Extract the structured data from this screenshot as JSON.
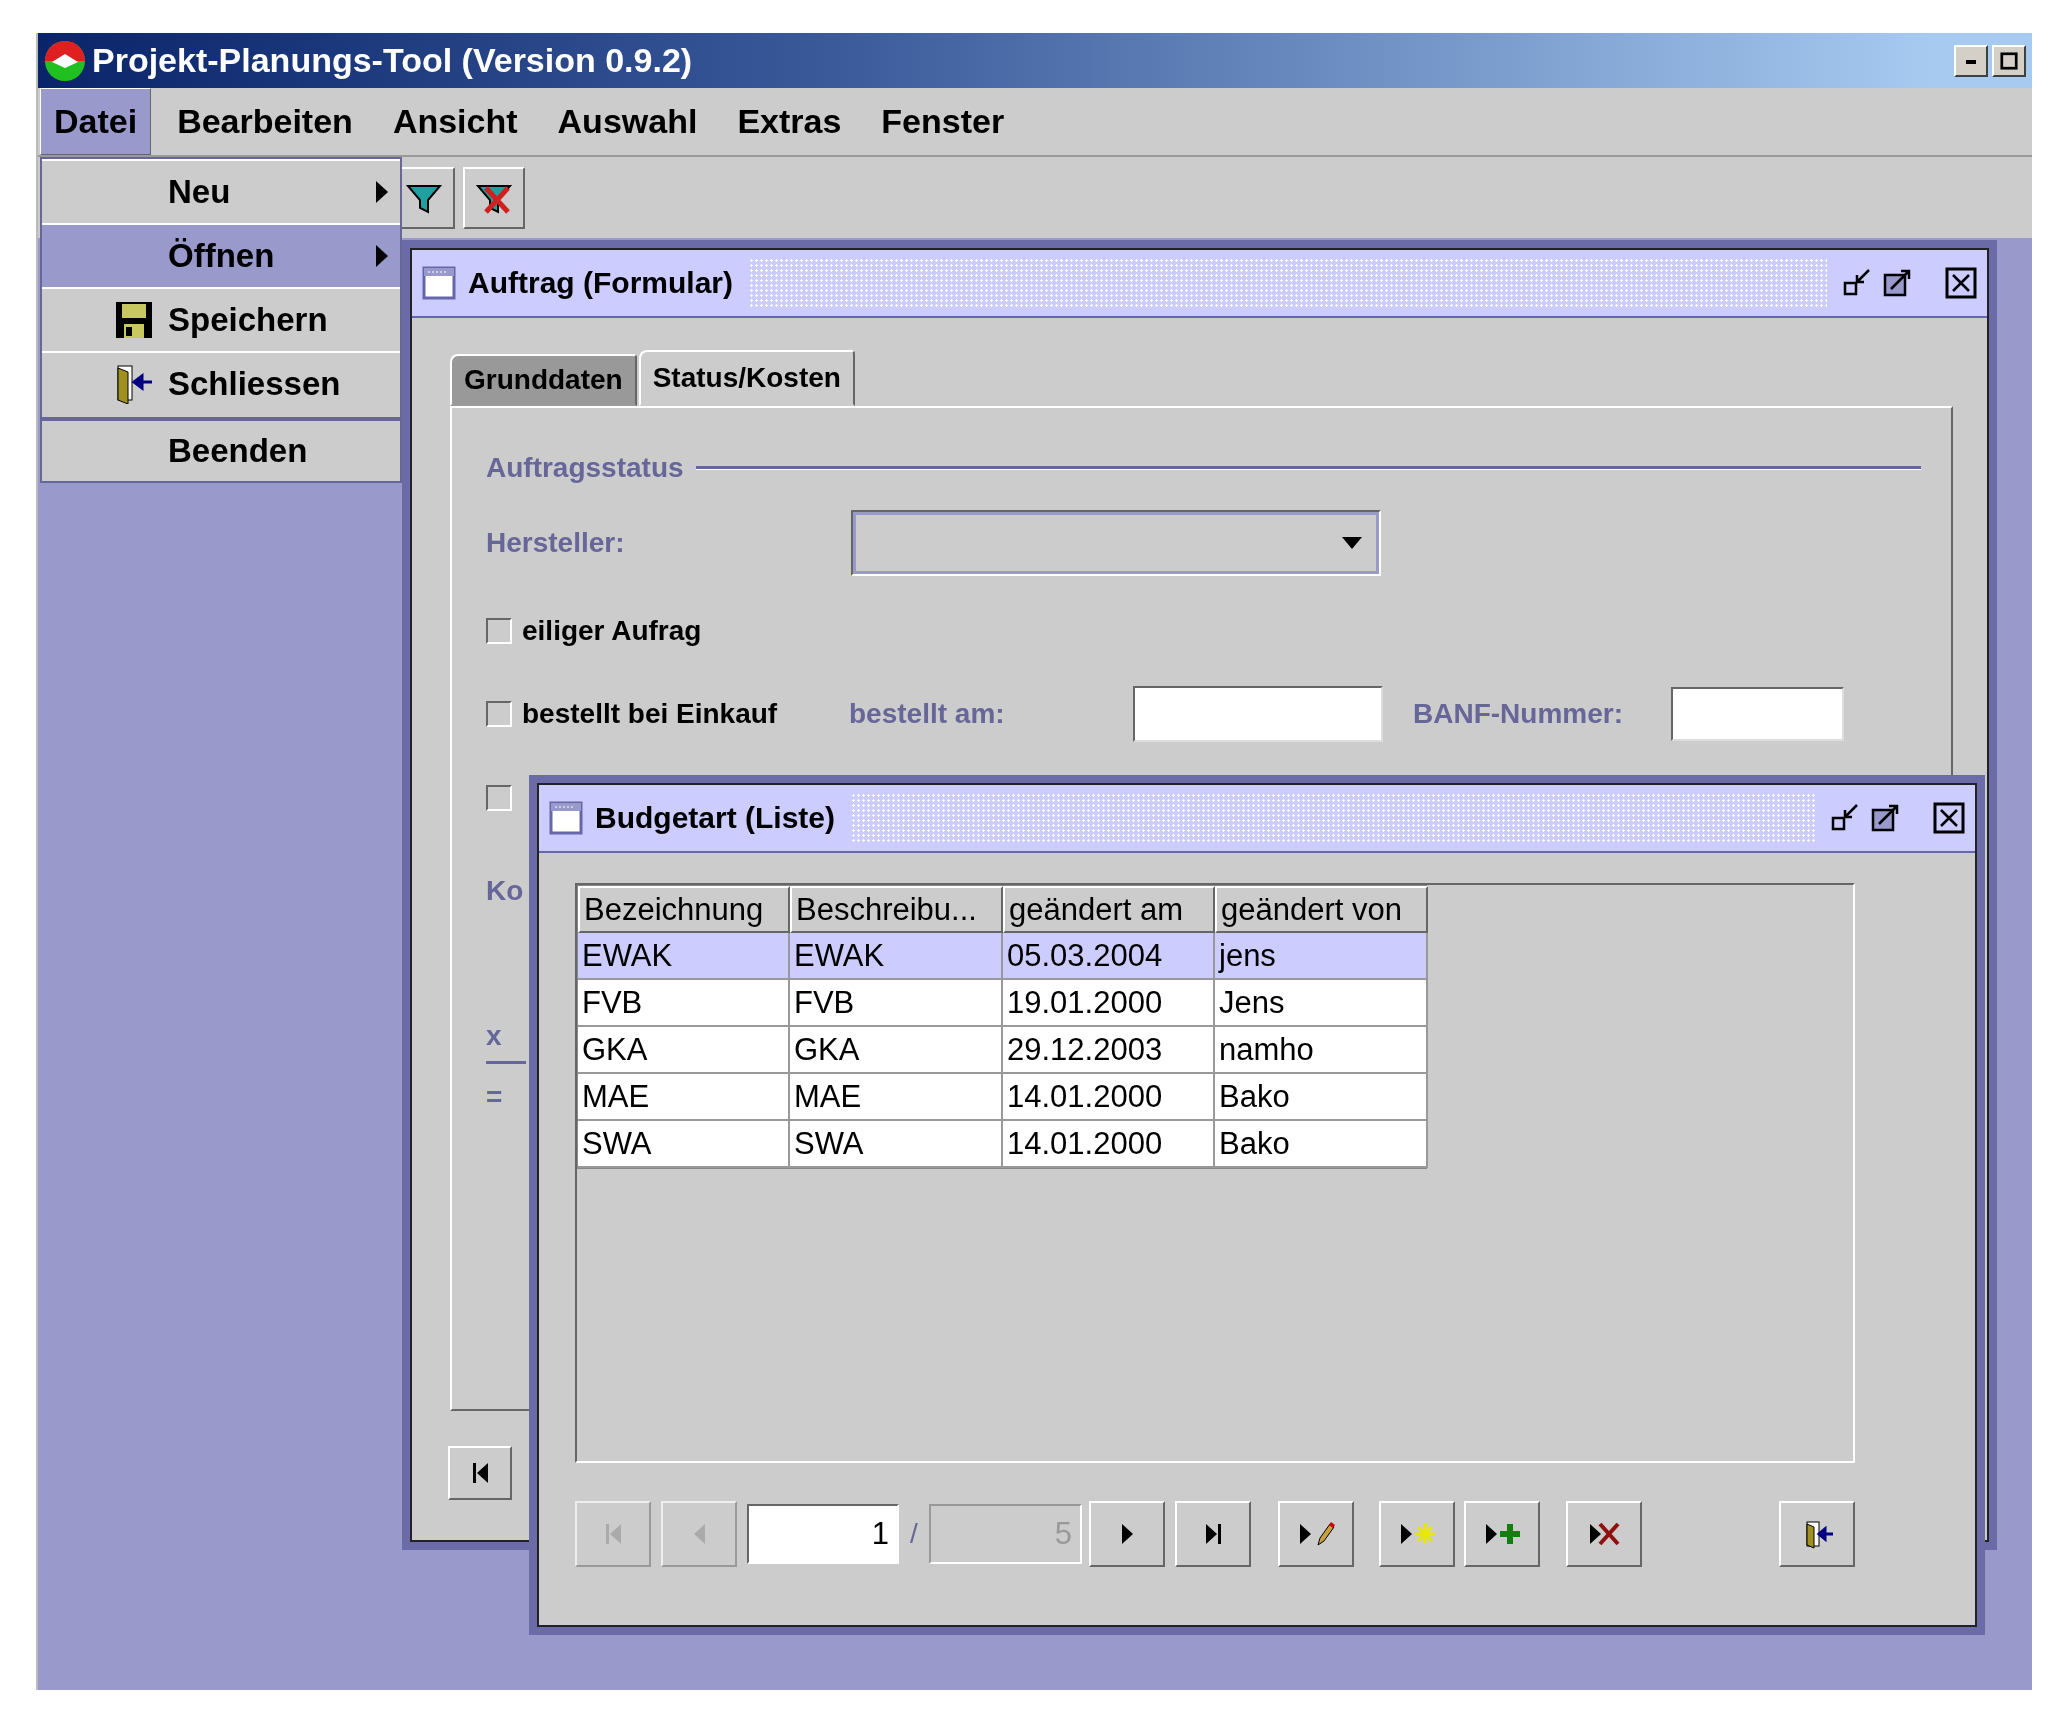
{
  "window": {
    "title": "Projekt-Planungs-Tool (Version 0.9.2)"
  },
  "menu_bar": [
    {
      "label": "Datei",
      "selected": true
    },
    {
      "label": "Bearbeiten",
      "selected": false
    },
    {
      "label": "Ansicht",
      "selected": false
    },
    {
      "label": "Auswahl",
      "selected": false
    },
    {
      "label": "Extras",
      "selected": false
    },
    {
      "label": "Fenster",
      "selected": false
    }
  ],
  "file_menu": [
    {
      "label": "Neu",
      "kind": "submenu",
      "selected": false,
      "separator_before": false
    },
    {
      "label": "Öffnen",
      "kind": "submenu",
      "selected": true,
      "separator_before": false
    },
    {
      "label": "Speichern",
      "kind": "save",
      "selected": false,
      "separator_before": false
    },
    {
      "label": "Schliessen",
      "kind": "close",
      "selected": false,
      "separator_before": false
    },
    {
      "label": "Beenden",
      "kind": "plain",
      "selected": false,
      "separator_before": true
    }
  ],
  "toolbar": [
    {
      "kind": "filter"
    },
    {
      "kind": "filter-clear"
    }
  ],
  "order_form": {
    "title": "Auftrag (Formular)",
    "tabs": [
      {
        "label": "Grunddaten",
        "selected": false
      },
      {
        "label": "Status/Kosten",
        "selected": true
      }
    ],
    "section": "Auftragsstatus",
    "manufacturer": {
      "label": "Hersteller:"
    },
    "urgent": {
      "label": "eiliger Aufrag",
      "checked": false
    },
    "ordered": {
      "label": "bestellt bei Einkauf",
      "checked": false
    },
    "ordered_on": {
      "label": "bestellt am:"
    },
    "banf": {
      "label": "BANF-Nummer:"
    },
    "checkbox_3": {
      "checked": false
    },
    "cost_label": "Ko",
    "multiply_sign": "x",
    "equals_sign": "="
  },
  "budget_list": {
    "title": "Budgetart (Liste)",
    "columns": [
      "Bezeichnung",
      "Beschreibu...",
      "geändert am",
      "geändert von"
    ],
    "rows": [
      {
        "cells": [
          "EWAK",
          "EWAK",
          "05.03.2004",
          "jens"
        ],
        "selected": true
      },
      {
        "cells": [
          "FVB",
          "FVB",
          "19.01.2000",
          "Jens"
        ],
        "selected": false
      },
      {
        "cells": [
          "GKA",
          "GKA",
          "29.12.2003",
          "namho"
        ],
        "selected": false
      },
      {
        "cells": [
          "MAE",
          "MAE",
          "14.01.2000",
          "Bako"
        ],
        "selected": false
      },
      {
        "cells": [
          "SWA",
          "SWA",
          "14.01.2000",
          "Bako"
        ],
        "selected": false
      }
    ],
    "pager": {
      "current": "1",
      "separator": "/",
      "total": "5"
    },
    "buttons": [
      {
        "kind": "first",
        "disabled": true
      },
      {
        "kind": "prev",
        "disabled": true
      },
      {
        "kind": "next",
        "disabled": false
      },
      {
        "kind": "last",
        "disabled": false
      },
      {
        "kind": "edit",
        "disabled": false
      },
      {
        "kind": "new",
        "disabled": false
      },
      {
        "kind": "add",
        "disabled": false
      },
      {
        "kind": "delete",
        "disabled": false
      },
      {
        "kind": "exit",
        "disabled": false
      }
    ]
  }
}
